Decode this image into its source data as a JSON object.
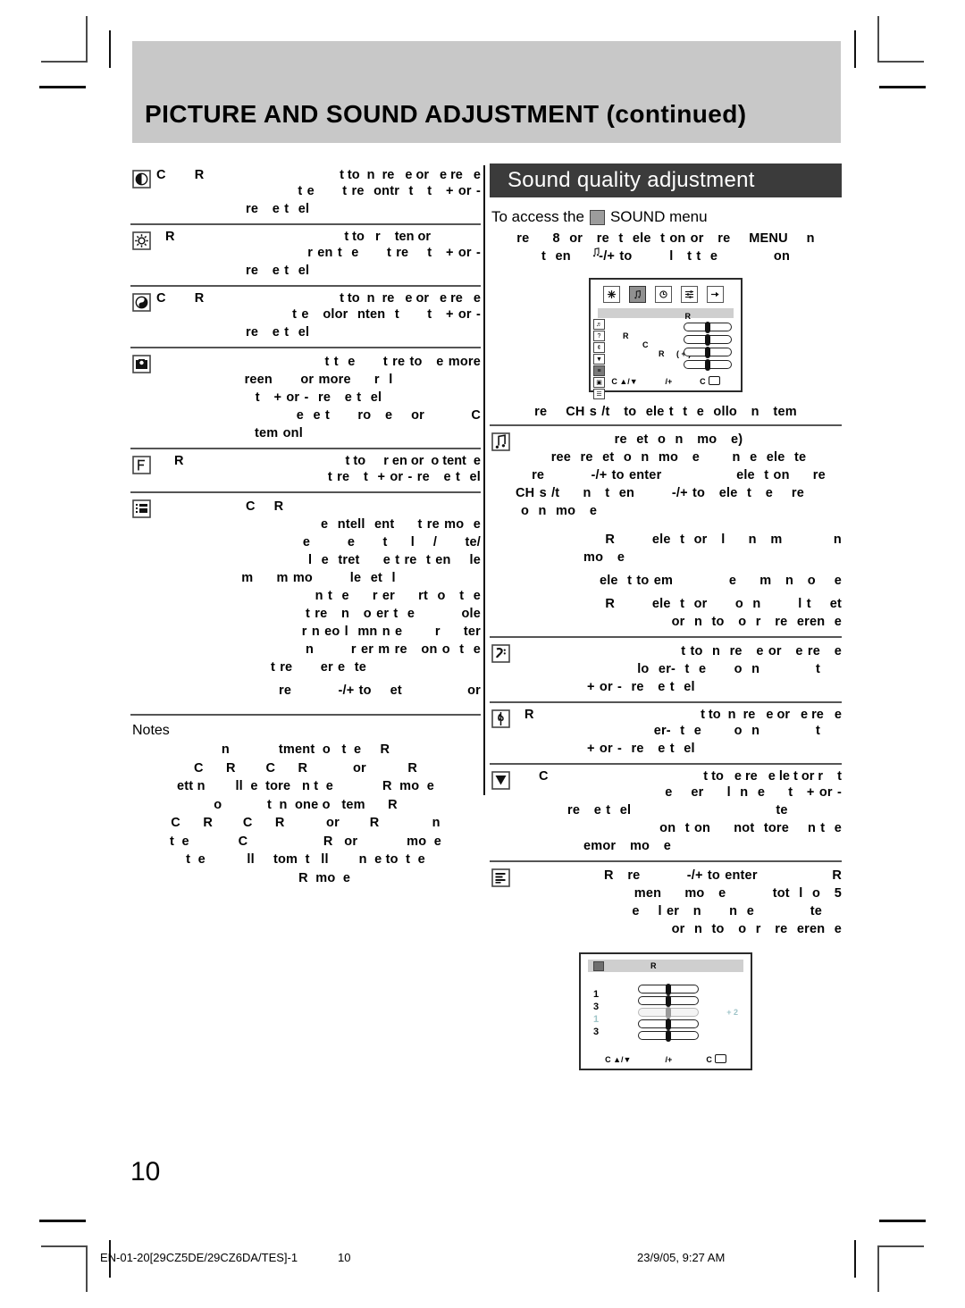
{
  "page": {
    "title": "PICTURE AND SOUND ADJUSTMENT (continued)",
    "number": "10"
  },
  "footer": {
    "file": "EN-01-20[29CZ5DE/29CZ6DA/TES]-1",
    "page": "10",
    "timestamp": "23/9/05, 9:27 AM"
  },
  "left_column": {
    "items": [
      {
        "icon": "contrast-icon",
        "lead": "C        R",
        "lines": [
          "t to  n  re   e or   e re   e",
          "t e      t re  ontr  t   t   + or -",
          "re   e t  el"
        ]
      },
      {
        "icon": "brightness-icon",
        "lead": "R",
        "lines": [
          "t to   r    ten or",
          "r en t  e      t re    t   + or -",
          "re   e t  el"
        ]
      },
      {
        "icon": "colour-icon",
        "lead": "C        R",
        "lines": [
          "t to  n  re   e or   e re   e",
          "t e   olor  nten  t      t   + or -",
          "re   e t  el"
        ]
      },
      {
        "icon": "sharpness-icon",
        "lead": "",
        "lines": [
          "t t  e      t re to   e more",
          "reen      or more     r  l",
          "t   + or -  re   e t  el",
          "e  e t      ro   e    or          C",
          "tem onl"
        ]
      },
      {
        "icon": "tint-icon",
        "lead": "R",
        "lines": [
          "t to     r en or  o tent  e",
          "t re   t  + or - re   e t  el"
        ]
      },
      {
        "icon": "picture-mode-icon",
        "lead": "C    R",
        "lines": [
          "e  ntell  ent     t re mo  e",
          "e        e      t     l    /      te/",
          "l  e  tret     e t re  t en    le",
          "m     m mo        le  et  l",
          "n t  e     r er     rt  o   t  e",
          "t re   n   o er t  e          ole",
          "r n eo l  mn n e       r     ter",
          "n        r er m re   on o  t  e",
          "t re      er e  te",
          "re          -/+ to    et              or"
        ]
      }
    ],
    "notes": {
      "title": "Notes",
      "lines": [
        "n             tment  o   t  e     R",
        "C      R        C      R            or           R",
        "ett n        ll  e  tore   n t  e             R  mo  e",
        "o            t  n  one o   tem      R",
        "C      R        C      R           or        R              n",
        "t  e             C                    R   or             mo  e",
        "t  e           ll     tom  t   ll        n  e to  t  e",
        "          R  mo  e"
      ]
    }
  },
  "right_column": {
    "banner": "Sound quality adjustment",
    "access_line_before": "To access the",
    "access_line_after": "SOUND menu",
    "access_icon": "sound-note-icon",
    "intro_lines": [
      "re     8  or   re  t  ele  t on or   re    MENU    n",
      "t  en      -/+ to        l   t t  e            on"
    ],
    "osd_top": {
      "tabs": [
        "picture-tab-icon",
        "sound-tab-icon",
        "timer-tab-icon",
        "feature-tab-icon",
        "install-tab-icon"
      ],
      "selected_tab_index": 1,
      "side_items": 7,
      "selected_side_index": 4,
      "labels": {
        "top_right": "R",
        "left_1": "R",
        "left_2": "C",
        "left_3": "R",
        "plus": "( + )"
      },
      "sliders": 4,
      "footer": [
        "C ▲/▼",
        "/+",
        "C"
      ]
    },
    "list_header": "re    CH s /t   to  ele t  t  e  ollo   n   tem",
    "items": [
      {
        "icon": "sound-note-icon",
        "lead": "",
        "lines": [
          "re  et  o  n   mo   e)",
          "ree  re  et  o  n  mo   e       n  e  ele  te",
          "re          -/+ to enter                ele  t on     re",
          "CH s /t     n   t  en        -/+ to   ele  t   e    re",
          "o  n  mo   e"
        ],
        "extra_lines": [
          "R        ele  t  or   l     n   m           n",
          "mo   e",
          "ele  t to em            e     m   n   o    e",
          "R        ele  t  or      o  n        l t    et",
          "or  n  to   o  r   re  eren  e"
        ]
      },
      {
        "icon": "bass-icon",
        "lead": "",
        "lines": [
          "t to  n  re   e or   e re   e",
          "lo  er-  t  e      o  n            t",
          "+ or -  re   e t  el"
        ]
      },
      {
        "icon": "treble-icon",
        "lead": "R",
        "lines": [
          "t to  n  re   e or   e re   e",
          "er-  t  e       o  n            t",
          "+ or -  re   e t  el"
        ]
      },
      {
        "icon": "balance-icon",
        "lead": "C",
        "lines": [
          "t to   e re   e le t or r    t",
          "e    er     l  n  e     t   + or -",
          "re   e t  el                               te",
          "on  t on     not  tore    n t  e",
          "emor   mo   e"
        ]
      },
      {
        "icon": "equalizer-icon",
        "lead": "",
        "lines": [
          "R   re          -/+ to enter                R",
          "men     mo   e          tot  l  o   5",
          "e    l er   n      n  e            te",
          "or  n  to   o  r   re  eren  e"
        ]
      }
    ],
    "osd_bottom": {
      "title_icon": "equalizer-icon",
      "title": "R",
      "levels": [
        "1",
        "3",
        "1",
        "3",
        ""
      ],
      "dim_level_index": 2,
      "value_label": "+ 2",
      "footer": [
        "C ▲/▼",
        "/+",
        "C"
      ]
    }
  }
}
